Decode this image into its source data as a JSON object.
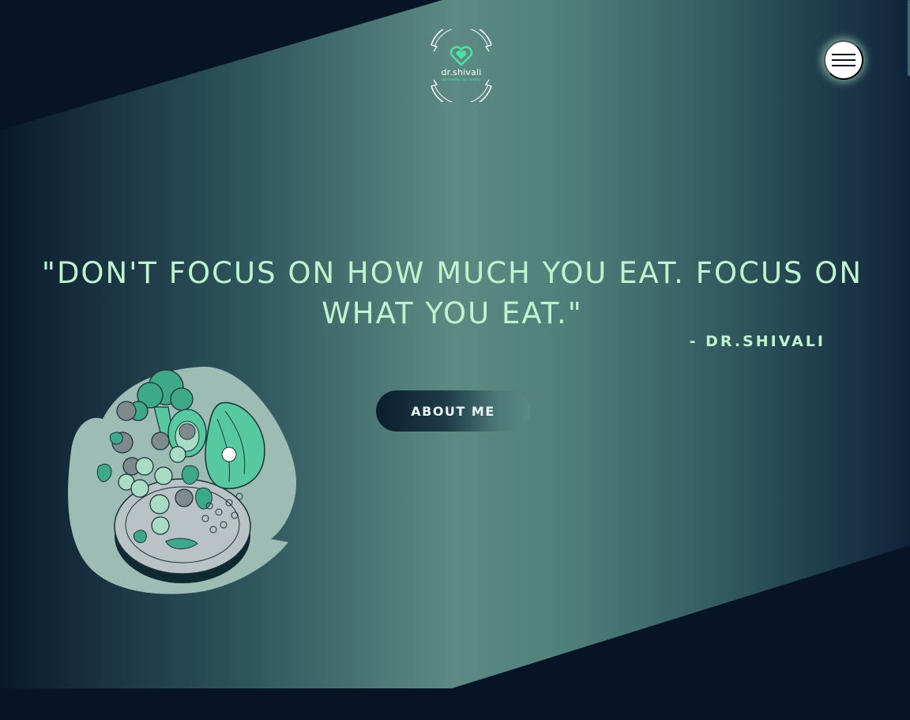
{
  "header": {
    "logo": {
      "name": "dr.shivali",
      "tagline": "eat healthy stay healthy",
      "icon": "heart-icon"
    },
    "menu_button": {
      "icon": "hamburger-icon"
    }
  },
  "hero": {
    "quote": "\"DON'T FOCUS ON HOW MUCH YOU EAT. FOCUS ON WHAT YOU EAT.\"",
    "author": "- DR.SHIVALI",
    "about_button_label": "ABOUT ME",
    "illustration": "healthy-food-bowl-illustration"
  },
  "colors": {
    "page_background": "#061426",
    "gradient_center": "#5c8a83",
    "quote_text": "#bff5cd",
    "accent_green": "#4fe0a4",
    "illustration_blob": "#9cbcb4",
    "leaf_green": "#3ea988"
  }
}
